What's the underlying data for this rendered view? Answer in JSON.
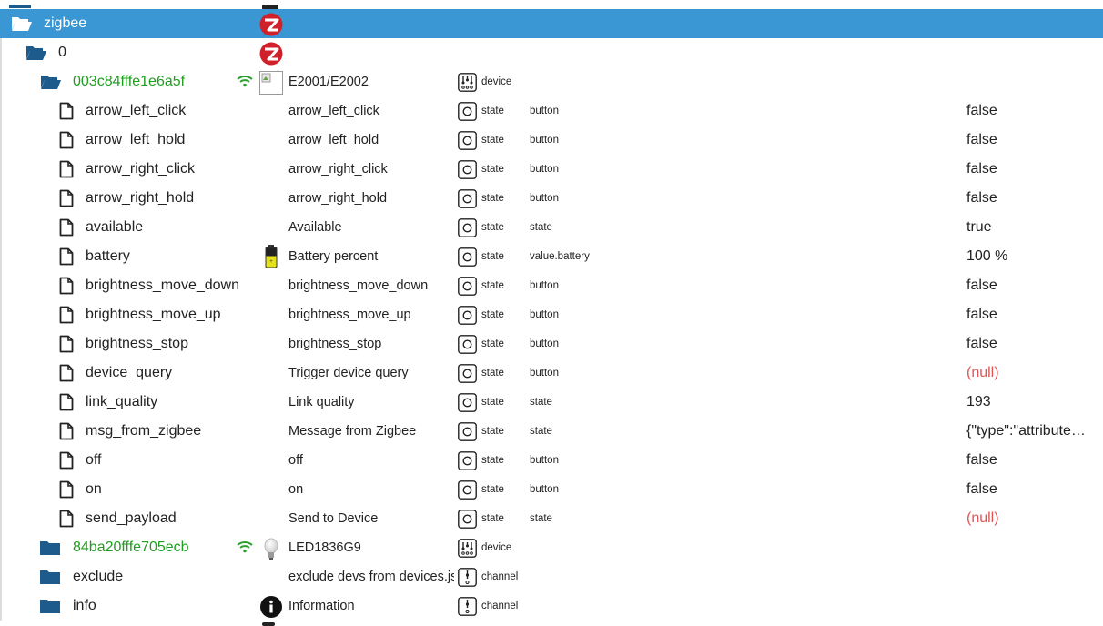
{
  "rows": [
    {
      "name": "zigbee",
      "icon": "folder-open-icon",
      "title": "",
      "role": "",
      "type": "",
      "value": "",
      "selected": true
    },
    {
      "name": "0",
      "icon": "folder-open-icon",
      "title": "",
      "role": "",
      "type": "",
      "value": ""
    },
    {
      "name": "003c84fffe1e6a5f",
      "icon": "folder-open-icon",
      "title": "E2001/E2002",
      "role": "device",
      "type": "",
      "value": "",
      "green": true
    },
    {
      "name": "arrow_left_click",
      "icon": "file-icon",
      "title": "arrow_left_click",
      "role": "state",
      "type": "button",
      "value": "false"
    },
    {
      "name": "arrow_left_hold",
      "icon": "file-icon",
      "title": "arrow_left_hold",
      "role": "state",
      "type": "button",
      "value": "false"
    },
    {
      "name": "arrow_right_click",
      "icon": "file-icon",
      "title": "arrow_right_click",
      "role": "state",
      "type": "button",
      "value": "false"
    },
    {
      "name": "arrow_right_hold",
      "icon": "file-icon",
      "title": "arrow_right_hold",
      "role": "state",
      "type": "button",
      "value": "false"
    },
    {
      "name": "available",
      "icon": "file-icon",
      "title": "Available",
      "role": "state",
      "type": "state",
      "value": "true"
    },
    {
      "name": "battery",
      "icon": "file-icon",
      "title": "Battery percent",
      "role": "state",
      "type": "value.battery",
      "value": "100 %"
    },
    {
      "name": "brightness_move_down",
      "icon": "file-icon",
      "title": "brightness_move_down",
      "role": "state",
      "type": "button",
      "value": "false"
    },
    {
      "name": "brightness_move_up",
      "icon": "file-icon",
      "title": "brightness_move_up",
      "role": "state",
      "type": "button",
      "value": "false"
    },
    {
      "name": "brightness_stop",
      "icon": "file-icon",
      "title": "brightness_stop",
      "role": "state",
      "type": "button",
      "value": "false"
    },
    {
      "name": "device_query",
      "icon": "file-icon",
      "title": "Trigger device query",
      "role": "state",
      "type": "button",
      "value": "(null)"
    },
    {
      "name": "link_quality",
      "icon": "file-icon",
      "title": "Link quality",
      "role": "state",
      "type": "state",
      "value": "193"
    },
    {
      "name": "msg_from_zigbee",
      "icon": "file-icon",
      "title": "Message from Zigbee",
      "role": "state",
      "type": "state",
      "value": "{\"type\":\"attribute…"
    },
    {
      "name": "off",
      "icon": "file-icon",
      "title": "off",
      "role": "state",
      "type": "button",
      "value": "false"
    },
    {
      "name": "on",
      "icon": "file-icon",
      "title": "on",
      "role": "state",
      "type": "button",
      "value": "false"
    },
    {
      "name": "send_payload",
      "icon": "file-icon",
      "title": "Send to Device",
      "role": "state",
      "type": "state",
      "value": "(null)"
    },
    {
      "name": "84ba20fffe705ecb",
      "icon": "folder-closed-icon",
      "title": "LED1836G9",
      "role": "device",
      "type": "",
      "value": "",
      "green": true
    },
    {
      "name": "exclude",
      "icon": "folder-closed-icon",
      "title": "exclude devs from devices.js",
      "role": "channel",
      "type": "",
      "value": ""
    },
    {
      "name": "info",
      "icon": "folder-closed-icon",
      "title": "Information",
      "role": "channel",
      "type": "",
      "value": ""
    }
  ],
  "colors": {
    "selected_bg": "#3a97d3",
    "green_text": "#1f9d1f",
    "null_text": "#e05555",
    "wifi_green": "#2ca02c",
    "zigbee_red": "#d0202a"
  }
}
